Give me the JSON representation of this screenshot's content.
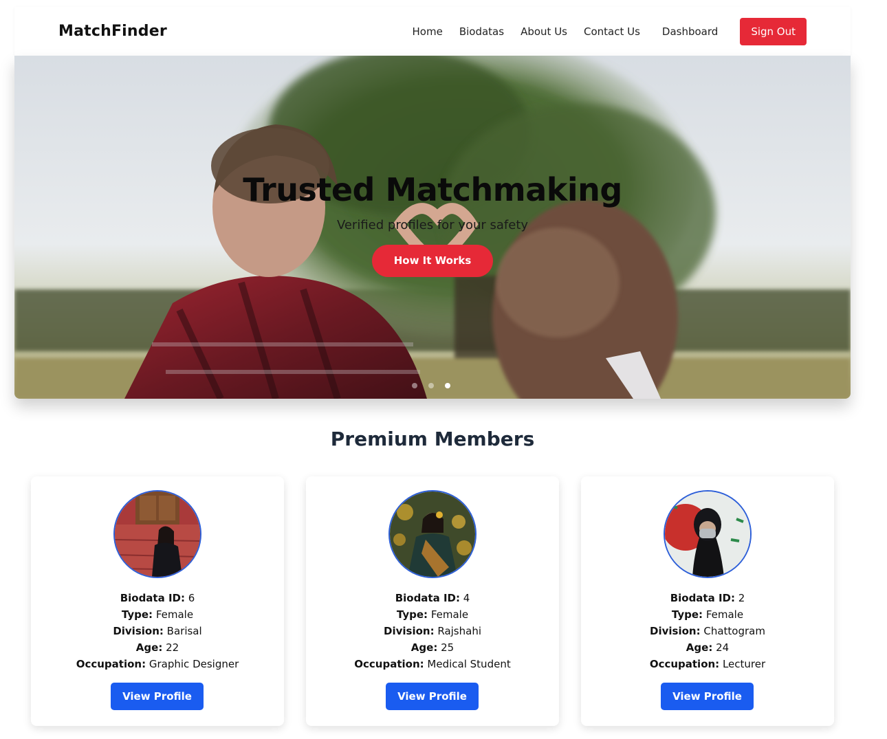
{
  "navbar": {
    "brand": "MatchFinder",
    "links": [
      "Home",
      "Biodatas",
      "About Us",
      "Contact Us",
      "Dashboard"
    ],
    "signout_label": "Sign Out",
    "signout_color": "#e62937"
  },
  "hero": {
    "title": "Trusted Matchmaking",
    "subtitle": "Verified profiles for your safety",
    "button_label": "How It Works",
    "slides_total": 3,
    "active_slide": 3
  },
  "premium": {
    "title": "Premium Members",
    "labels": {
      "id": "Biodata ID:",
      "type": "Type:",
      "division": "Division:",
      "age": "Age:",
      "occupation": "Occupation:"
    },
    "button_label": "View Profile",
    "members": [
      {
        "id": "6",
        "type": "Female",
        "division": "Barisal",
        "age": "22",
        "occupation": "Graphic Designer"
      },
      {
        "id": "4",
        "type": "Female",
        "division": "Rajshahi",
        "age": "25",
        "occupation": "Medical Student"
      },
      {
        "id": "2",
        "type": "Female",
        "division": "Chattogram",
        "age": "24",
        "occupation": "Lecturer"
      }
    ]
  },
  "colors": {
    "accent_red": "#e62937",
    "primary_blue": "#1a5cf0",
    "avatar_border": "#2d5fd8"
  }
}
